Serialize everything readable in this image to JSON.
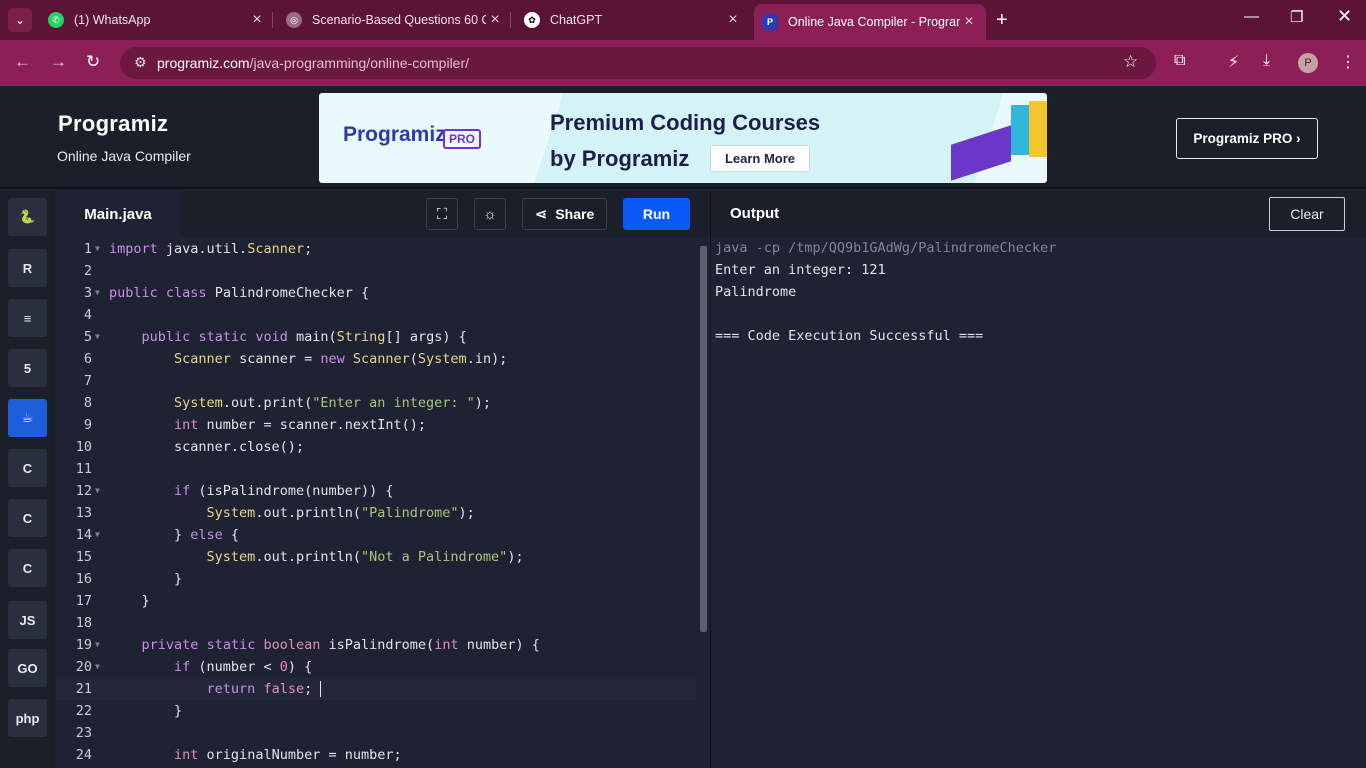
{
  "browser": {
    "tabs": [
      {
        "title": "(1) WhatsApp",
        "active": false
      },
      {
        "title": "Scenario-Based Questions 60 Q",
        "active": false
      },
      {
        "title": "ChatGPT",
        "active": false
      },
      {
        "title": "Online Java Compiler - Program",
        "active": true
      }
    ],
    "url_host": "programiz.com",
    "url_path": "/java-programming/online-compiler/",
    "profile_initial": "P"
  },
  "header": {
    "logo": "Programiz",
    "subtitle": "Online Java Compiler",
    "banner": {
      "logo": "Programiz",
      "badge": "PRO",
      "line1": "Premium Coding Courses",
      "line2": "by Programiz",
      "cta": "Learn More"
    },
    "pro_button": "Programiz PRO ›"
  },
  "rail": {
    "languages": [
      {
        "name": "python",
        "glyph": "🐍",
        "active": false
      },
      {
        "name": "r",
        "glyph": "R",
        "active": false
      },
      {
        "name": "sql",
        "glyph": "≡",
        "active": false
      },
      {
        "name": "html",
        "glyph": "5",
        "active": false
      },
      {
        "name": "java",
        "glyph": "☕",
        "active": true
      },
      {
        "name": "c",
        "glyph": "C",
        "active": false
      },
      {
        "name": "cpp",
        "glyph": "C",
        "active": false
      },
      {
        "name": "csharp",
        "glyph": "C",
        "active": false
      },
      {
        "name": "js",
        "glyph": "JS",
        "active": false
      },
      {
        "name": "go",
        "glyph": "GO",
        "active": false
      },
      {
        "name": "php",
        "glyph": "php",
        "active": false
      }
    ]
  },
  "editor": {
    "filename": "Main.java",
    "share_label": "Share",
    "run_label": "Run",
    "lines": [
      "import java.util.Scanner;",
      "",
      "public class PalindromeChecker {",
      "",
      "    public static void main(String[] args) {",
      "        Scanner scanner = new Scanner(System.in);",
      "",
      "        System.out.print(\"Enter an integer: \");",
      "        int number = scanner.nextInt();",
      "        scanner.close();",
      "",
      "        if (isPalindrome(number)) {",
      "            System.out.println(\"Palindrome\");",
      "        } else {",
      "            System.out.println(\"Not a Palindrome\");",
      "        }",
      "    }",
      "",
      "    private static boolean isPalindrome(int number) {",
      "        if (number < 0) {",
      "            return false;",
      "        }",
      "",
      "        int originalNumber = number;"
    ],
    "current_line": 21
  },
  "output": {
    "title": "Output",
    "clear_label": "Clear",
    "lines": [
      "java -cp /tmp/QQ9b1GAdWg/PalindromeChecker",
      "Enter an integer: 121",
      "Palindrome",
      "",
      "=== Code Execution Successful ==="
    ]
  }
}
